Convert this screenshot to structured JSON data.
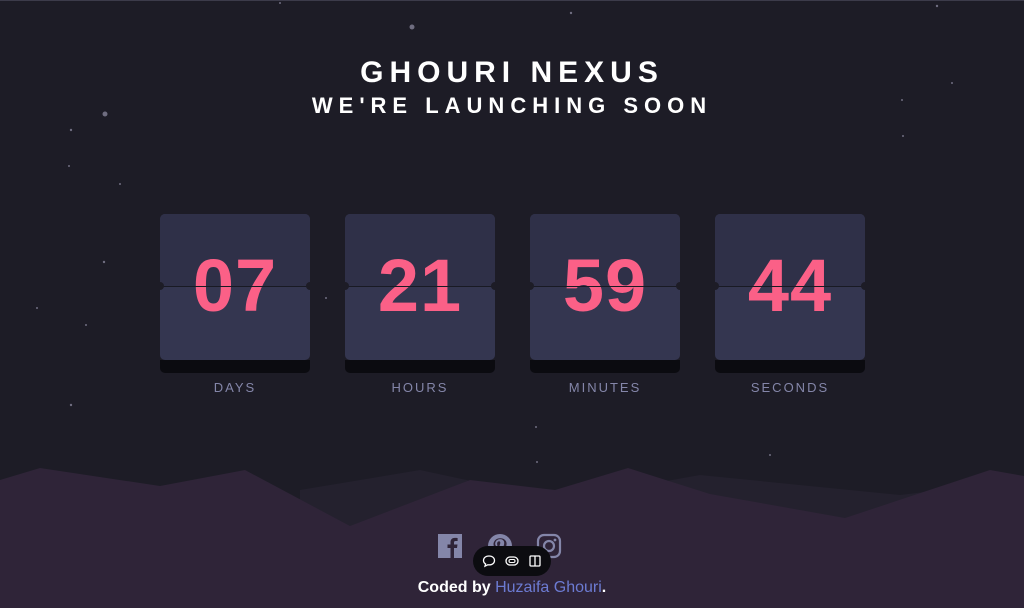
{
  "header": {
    "brand": "GHOURI NEXUS",
    "tagline": "WE'RE LAUNCHING SOON"
  },
  "countdown": [
    {
      "value": "07",
      "label": "DAYS"
    },
    {
      "value": "21",
      "label": "HOURS"
    },
    {
      "value": "59",
      "label": "MINUTES"
    },
    {
      "value": "44",
      "label": "SECONDS"
    }
  ],
  "social": [
    {
      "icon": "facebook-icon"
    },
    {
      "icon": "pinterest-icon"
    },
    {
      "icon": "instagram-icon"
    }
  ],
  "footer": {
    "credit_prefix": "Coded by",
    "author": "Huzaifa Ghouri",
    "credit_suffix": "."
  },
  "floating_toolbar": {
    "icons": [
      "comment-icon",
      "preview-icon",
      "columns-icon"
    ]
  },
  "colors": {
    "background": "#1d1c26",
    "card": "#343650",
    "number": "#fb6087",
    "label": "#8486a9",
    "hills": "#2f2438",
    "link": "#6c7bd2"
  }
}
